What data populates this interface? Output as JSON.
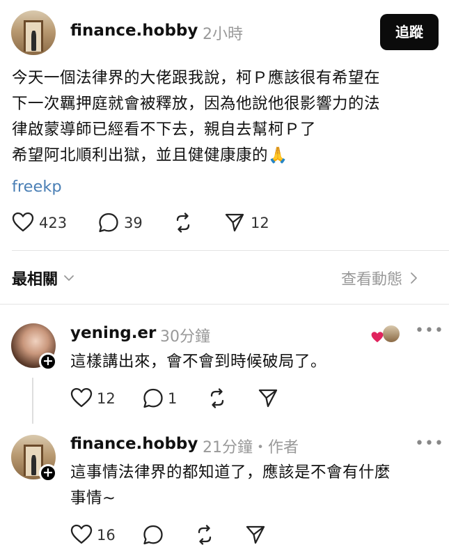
{
  "post": {
    "username": "finance.hobby",
    "time": "2小時",
    "follow_label": "追蹤",
    "lines": [
      "今天一個法律界的大佬跟我說，柯Ｐ應該很有希望在",
      "下一次羈押庭就會被釋放，因為他說他很影響力的法",
      "律啟蒙導師已經看不下去，親自去幫柯Ｐ了",
      "希望阿北順利出獄，並且健健康康的🙏"
    ],
    "tag": "freekp",
    "likes": "423",
    "comments": "39",
    "shares": "12"
  },
  "sort": {
    "label": "最相關",
    "view_activity": "查看動態"
  },
  "replies": [
    {
      "username": "yening.er",
      "time": "30分鐘",
      "text": "這樣講出來，會不會到時候破局了。",
      "likes": "12",
      "comments": "1"
    },
    {
      "username": "finance.hobby",
      "time": "21分鐘・作者",
      "text_lines": [
        "這事情法律界的都知道了，應該是不會有什麼",
        "事情~"
      ],
      "likes": "16"
    }
  ],
  "colors": {
    "tag": "#4a7fb5",
    "heart_badge": "#e0245e",
    "meta": "#999999"
  }
}
